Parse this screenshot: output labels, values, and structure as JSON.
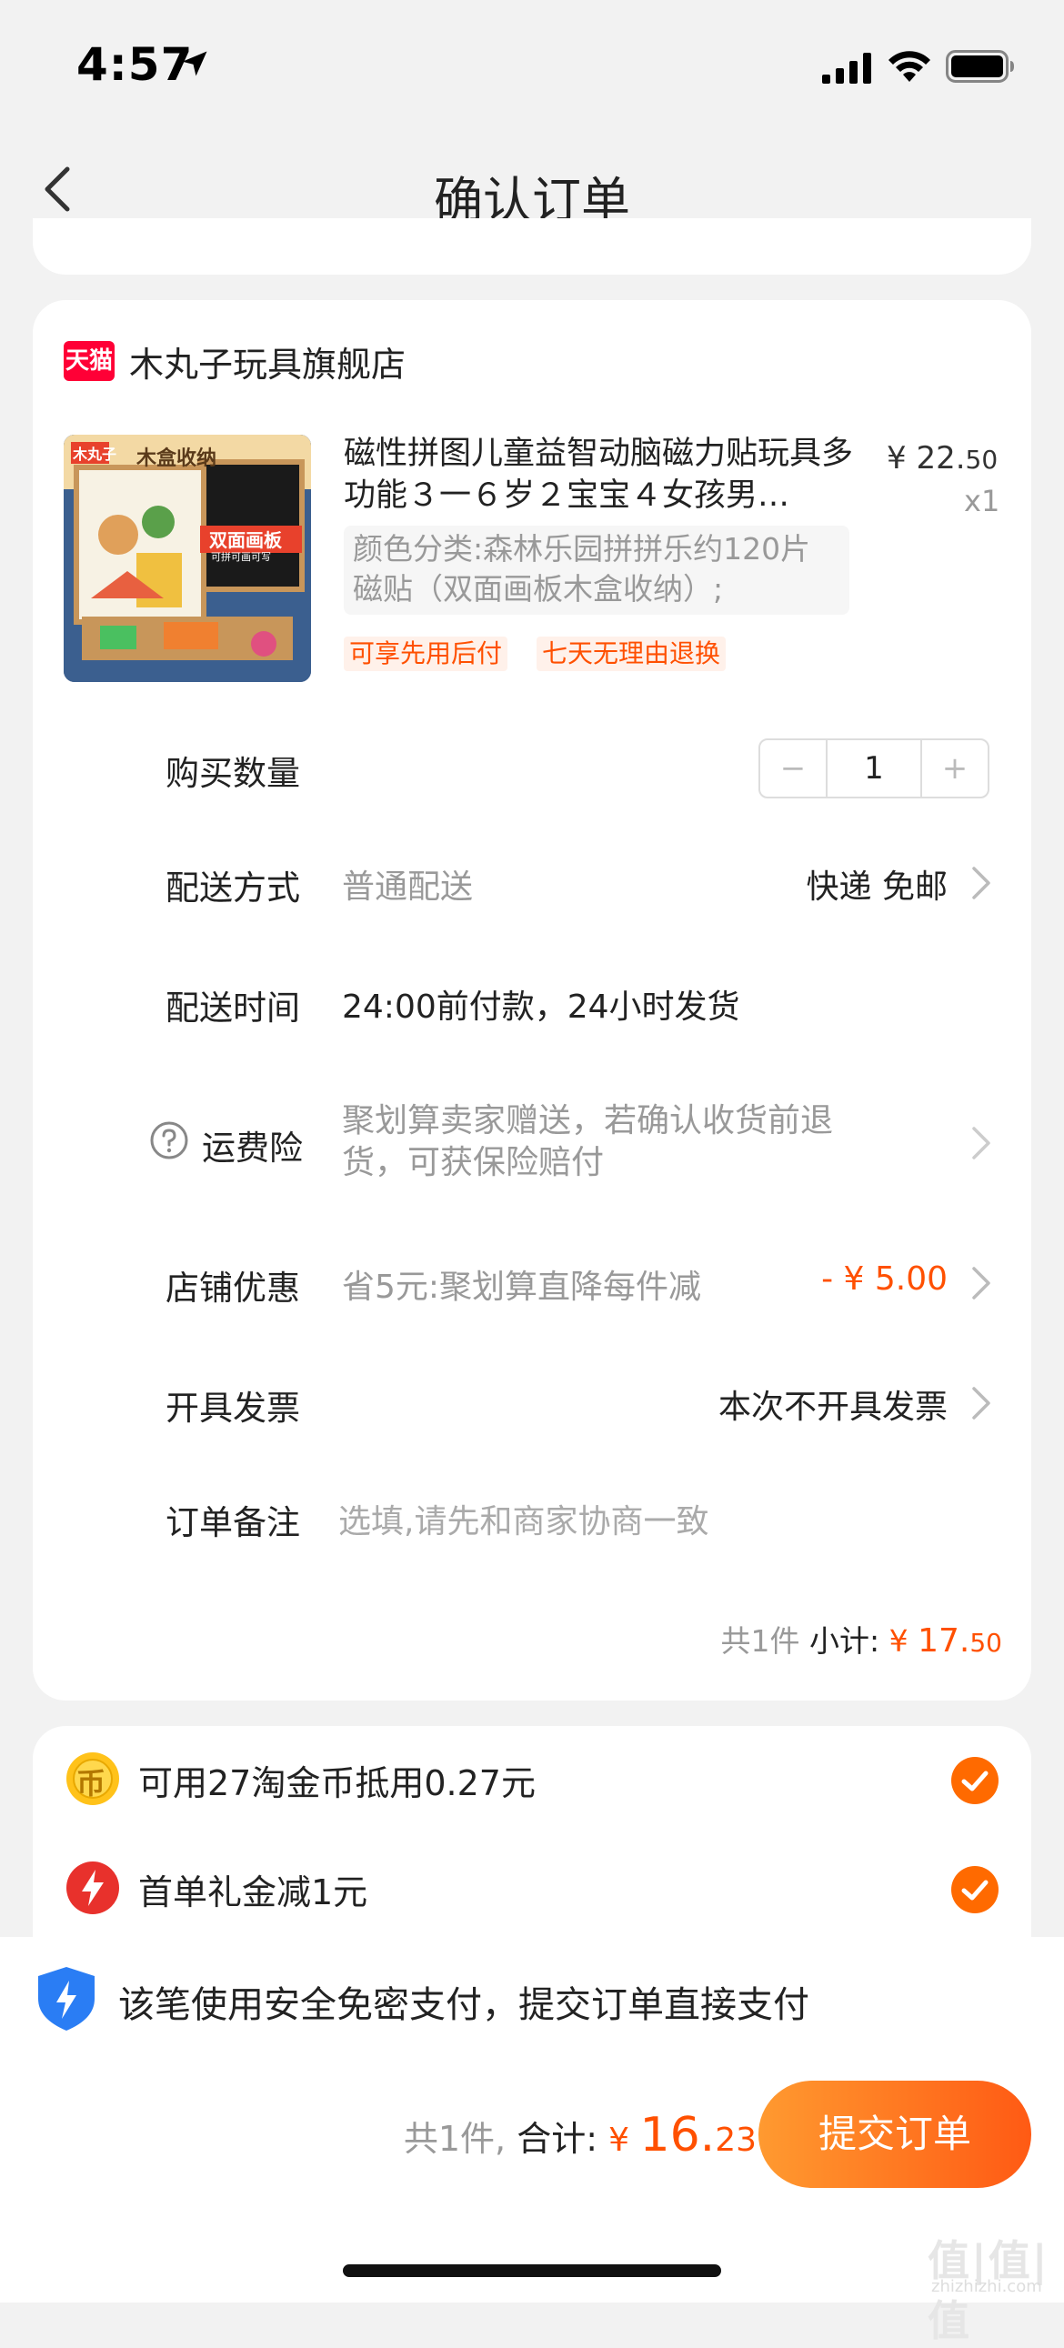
{
  "status": {
    "time": "4:57"
  },
  "nav": {
    "title": "确认订单"
  },
  "store": {
    "logo_text": "天猫",
    "name": "木丸子玩具旗舰店"
  },
  "product": {
    "title": "磁性拼图儿童益智动脑磁力贴玩具多功能３一６岁２宝宝４女孩男…",
    "price_int": "¥ 22.",
    "price_dec": "50",
    "quantity_label": "x1",
    "spec": "颜色分类:森林乐园拼拼乐约120片磁贴（双面画板木盒收纳）;",
    "tags": [
      "可享先用后付",
      "七天无理由退换"
    ],
    "image_text": {
      "brand": "木丸子",
      "box": "木盒收纳",
      "board": "双面画板",
      "board_sub": "可拼可画可写"
    }
  },
  "rows": {
    "quantity": {
      "label": "购买数量",
      "minus": "−",
      "value": "1",
      "plus": "+"
    },
    "delivery": {
      "label": "配送方式",
      "value": "普通配送",
      "right": "快递 免邮"
    },
    "delivery_time": {
      "label": "配送时间",
      "value": "24:00前付款，24小时发货"
    },
    "insurance": {
      "label": "运费险",
      "value": "聚划算卖家赠送，若确认收货前退货，可获保险赔付"
    },
    "discount": {
      "label": "店铺优惠",
      "value": "省5元:聚划算直降每件减",
      "right": "- ¥ 5.00"
    },
    "invoice": {
      "label": "开具发票",
      "right": "本次不开具发票"
    },
    "note": {
      "label": "订单备注",
      "placeholder": "选填,请先和商家协商一致"
    }
  },
  "subtotal": {
    "count": "共1件",
    "label": "小计:",
    "currency": "¥ ",
    "int": "17.",
    "dec": "50"
  },
  "promos": [
    {
      "icon_text": "币",
      "text": "可用27淘金币抵用0.27元"
    },
    {
      "text": "首单礼金减1元"
    }
  ],
  "bottom": {
    "secure_text": "该笔使用安全免密支付，提交订单直接支付",
    "count": "共1件,",
    "total_label": "合计:",
    "currency": "¥ ",
    "total_int": "16.",
    "total_dec": "23",
    "submit_label": "提交订单"
  },
  "watermark": {
    "main": "值|值|值",
    "sub": "zhizhizhi.com"
  },
  "colors": {
    "accent": "#ff5000",
    "submit_start": "#ff9a30",
    "submit_end": "#ff5a14",
    "bg": "#f2f2f2"
  }
}
